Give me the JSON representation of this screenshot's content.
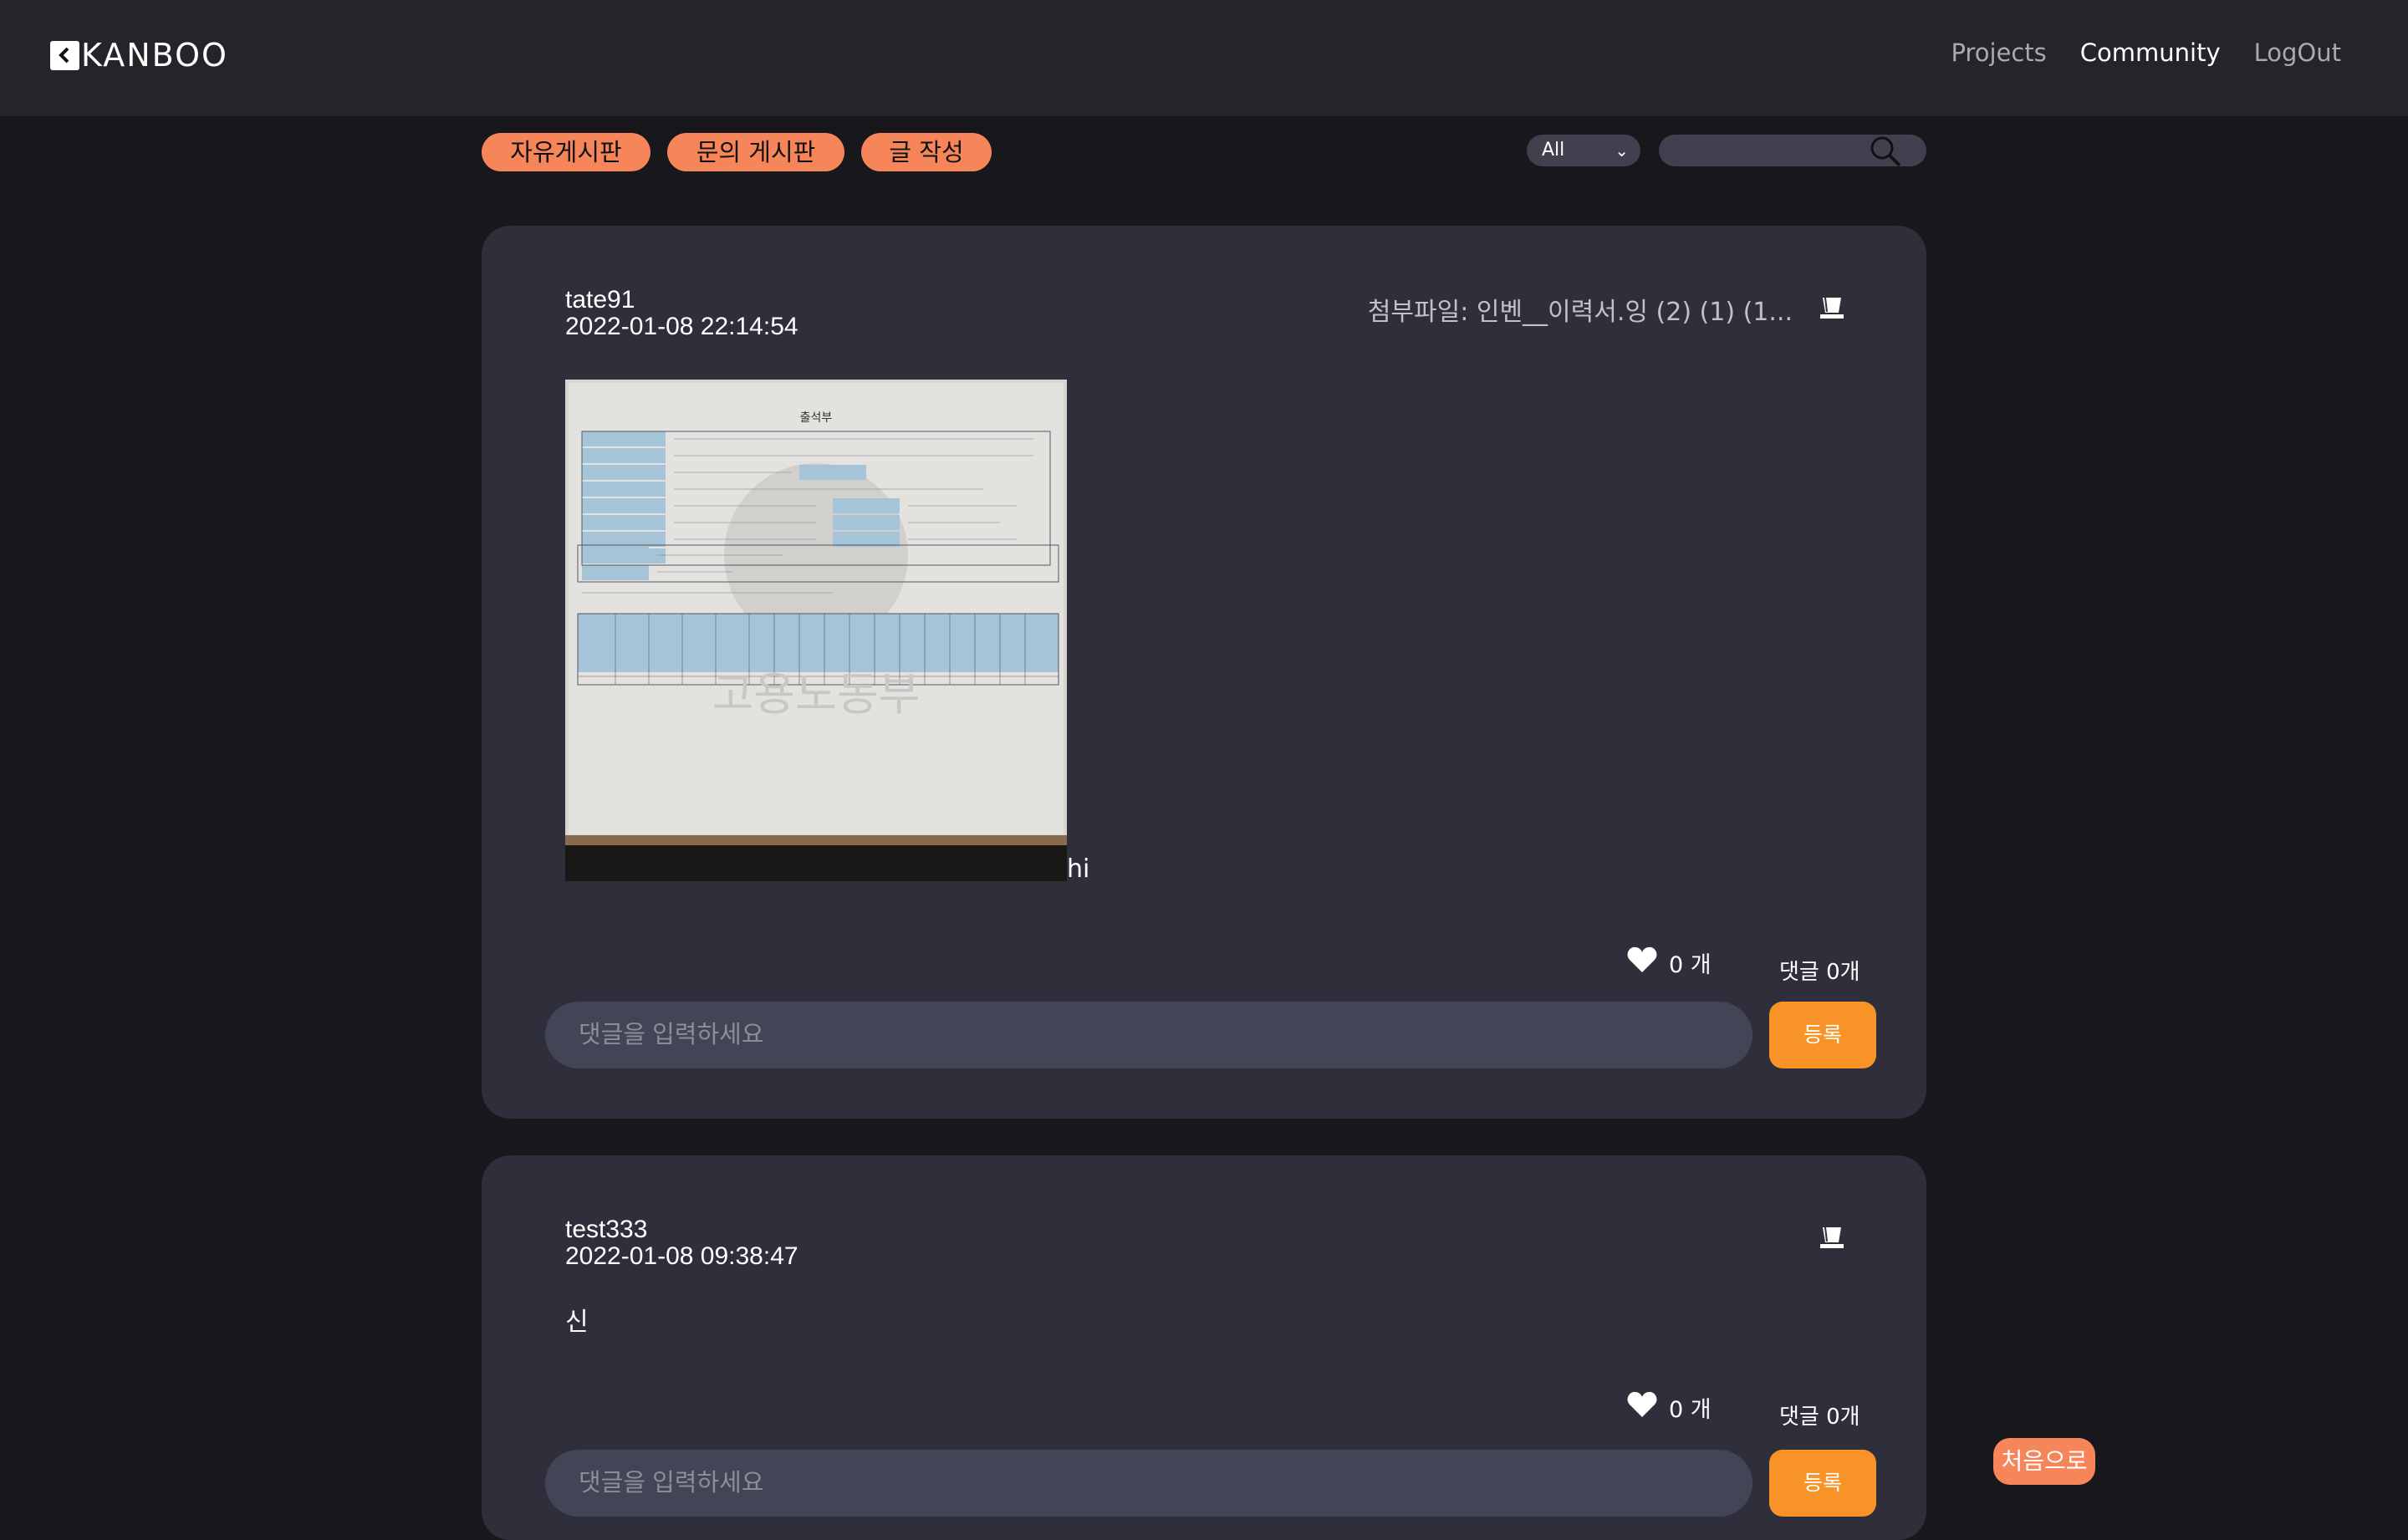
{
  "app": {
    "brand": "KANBOO"
  },
  "nav": {
    "projects": "Projects",
    "community": "Community",
    "logout": "LogOut"
  },
  "toolbar": {
    "free_board": "자유게시판",
    "qna_board": "문의 게시판",
    "write": "글 작성",
    "filter_value": "All",
    "search_placeholder": ""
  },
  "posts": [
    {
      "author": "tate91",
      "date": "2022-01-08 22:14:54",
      "attachment": "첨부파일: 인벤__이력서.잉 (2) (1) (1...",
      "text": "hi",
      "likes": "0 개",
      "comments": "댓글 0개",
      "comment_placeholder": "댓글을 입력하세요",
      "submit": "등록",
      "image_doc_title": "출석부",
      "image_watermark": "고용노동부"
    },
    {
      "author": "test333",
      "date": "2022-01-08 09:38:47",
      "text": "신",
      "likes": "0 개",
      "comments": "댓글 0개",
      "comment_placeholder": "댓글을 입력하세요",
      "submit": "등록"
    }
  ],
  "to_top": "처음으로",
  "colors": {
    "accent_pill": "#f7855a",
    "accent_button": "#f89427",
    "card": "#2e2f3a",
    "background": "#17171c"
  }
}
